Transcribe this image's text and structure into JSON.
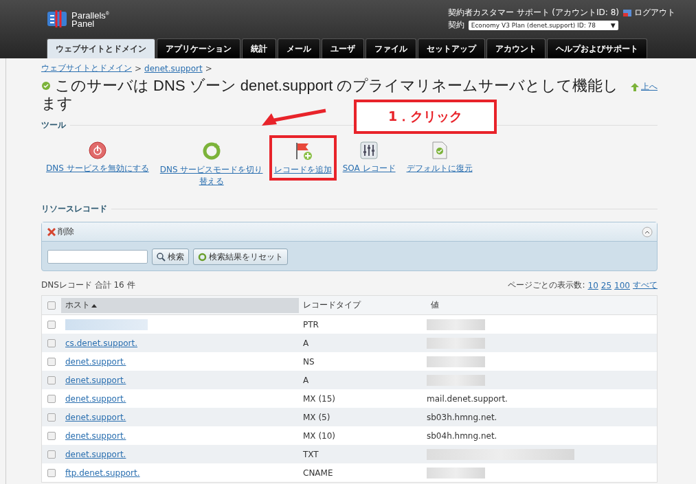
{
  "header": {
    "logo_line1": "Parallels",
    "logo_mark": "®",
    "logo_line2": "Panel",
    "account": "契約者カスタマー サポート (アカウントID: 8)",
    "logout": "ログアウト",
    "subscription_label": "契約",
    "subscription_value": "Economy V3 Plan (denet.support) ID: 78",
    "subscription_arrow": "▼"
  },
  "tabs": [
    {
      "label": "ウェブサイトとドメイン",
      "selected": true
    },
    {
      "label": "アプリケーション",
      "selected": false
    },
    {
      "label": "統計",
      "selected": false
    },
    {
      "label": "メール",
      "selected": false
    },
    {
      "label": "ユーザ",
      "selected": false
    },
    {
      "label": "ファイル",
      "selected": false
    },
    {
      "label": "セットアップ",
      "selected": false
    },
    {
      "label": "アカウント",
      "selected": false
    },
    {
      "label": "ヘルプおよびサポート",
      "selected": false
    }
  ],
  "breadcrumb": [
    {
      "label": "ウェブサイトとドメイン",
      "separator": ">"
    },
    {
      "label": "denet.support",
      "separator": ">"
    }
  ],
  "title": "このサーバは DNS ゾーン denet.support のプライマリネームサーバとして機能します",
  "up_link": "上へ",
  "tools_heading": "ツール",
  "tools": [
    {
      "kind": "disable",
      "label": "DNS サービスを無効にする",
      "highlighted": false
    },
    {
      "kind": "switch",
      "label": "DNS サービスモードを切り替える",
      "highlighted": false
    },
    {
      "kind": "add",
      "label": "レコードを追加",
      "highlighted": true
    },
    {
      "kind": "soa",
      "label": "SOA レコード",
      "highlighted": false
    },
    {
      "kind": "restore",
      "label": "デフォルトに復元",
      "highlighted": false
    }
  ],
  "annotation": {
    "callout": "1．クリック"
  },
  "resources_heading": "リソースレコード",
  "delete_button": "削除",
  "search": {
    "button": "検索",
    "reset_button": "検索結果をリセット"
  },
  "total": "DNSレコード 合計 16 件",
  "per_page": {
    "label": "ページごとの表示数:",
    "options": [
      {
        "label": "10"
      },
      {
        "label": "25"
      },
      {
        "label": "100"
      },
      {
        "label": "すべて"
      }
    ]
  },
  "table": {
    "select_all_checked": false,
    "columns": [
      {
        "label": "ホスト",
        "sorted": true
      },
      {
        "label": "レコードタイプ",
        "sorted": false
      },
      {
        "label": "値",
        "sorted": false
      }
    ],
    "rows": [
      {
        "checked": false,
        "host_blurred": true,
        "type": "PTR",
        "value_blurred": true
      },
      {
        "checked": false,
        "host": "cs.denet.support.",
        "type": "A",
        "value_blurred": true
      },
      {
        "checked": false,
        "host": "denet.support.",
        "type": "NS",
        "value_blurred": true
      },
      {
        "checked": false,
        "host": "denet.support.",
        "type": "A",
        "value_blurred": true
      },
      {
        "checked": false,
        "host": "denet.support.",
        "type": "MX (15)",
        "value": "mail.denet.support."
      },
      {
        "checked": false,
        "host": "denet.support.",
        "type": "MX (5)",
        "value": "sb03h.hmng.net."
      },
      {
        "checked": false,
        "host": "denet.support.",
        "type": "MX (10)",
        "value": "sb04h.hmng.net."
      },
      {
        "checked": false,
        "host": "denet.support.",
        "type": "TXT",
        "value_blurred": true,
        "wide": true
      },
      {
        "checked": false,
        "host": "ftp.denet.support.",
        "type": "CNAME",
        "value_blurred": true
      }
    ]
  }
}
